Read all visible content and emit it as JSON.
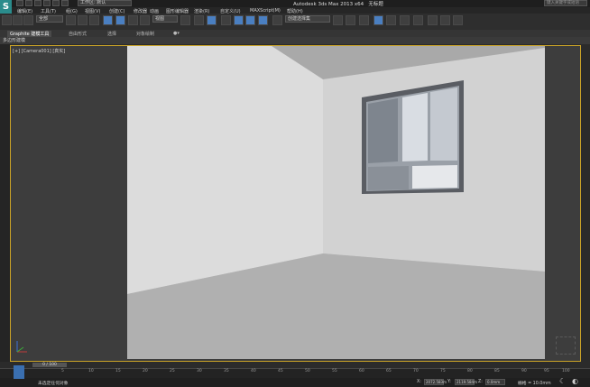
{
  "title_bar": {
    "app_logo": "S",
    "workspace_label": "工作区: 默认",
    "app_title": "Autodesk 3ds Max 2013 x64",
    "file_name": "无标题",
    "search_placeholder": "键入关键字或短语"
  },
  "menu": {
    "items": [
      "编辑(E)",
      "工具(T)",
      "组(G)",
      "视图(V)",
      "创建(C)",
      "修改器",
      "动画",
      "图形编辑器",
      "渲染(R)",
      "自定义(U)",
      "MAXScript(M)",
      "帮助(H)"
    ]
  },
  "toolbar": {
    "selection_filter": "全部",
    "view_dropdown": "视图",
    "named_selection": "创建选择集"
  },
  "ribbon": {
    "tabs": [
      "Graphite 建模工具",
      "自由形式",
      "选择",
      "对象绘制"
    ],
    "sub_label": "多边形建模"
  },
  "viewport": {
    "label": "[+] [Camera001] [真实]"
  },
  "timeline": {
    "frame_counter": "0 / 100",
    "ticks": [
      "0",
      "5",
      "10",
      "15",
      "20",
      "25",
      "30",
      "35",
      "40",
      "45",
      "50",
      "55",
      "60",
      "65",
      "70",
      "75",
      "80",
      "85",
      "90",
      "95",
      "100"
    ]
  },
  "status": {
    "message": "未选定任何对象",
    "x_label": "X:",
    "x_value": "2072.583m",
    "y_label": "Y:",
    "y_value": "2119.584m",
    "z_label": "Z:",
    "z_value": "0.0mm",
    "grid": "栅格 = 10.0mm"
  },
  "colors": {
    "accent": "#4a7fc1",
    "viewport_border": "#c9a227",
    "logo": "#2a8c8c"
  }
}
